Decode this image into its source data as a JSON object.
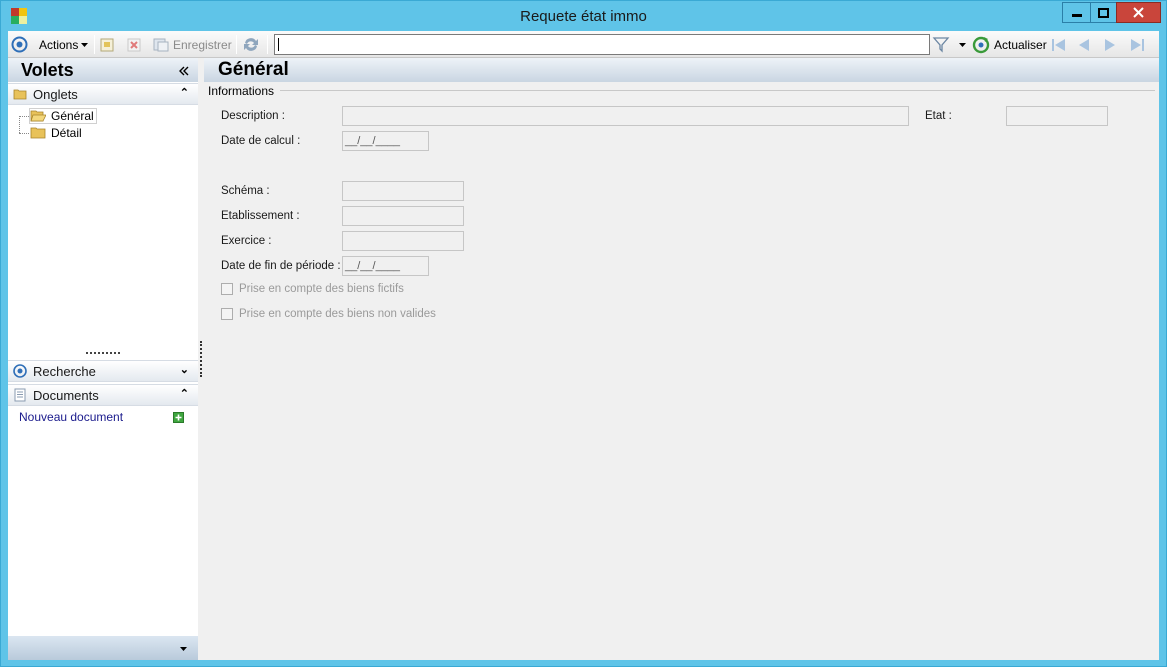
{
  "window": {
    "title": "Requete état immo"
  },
  "toolbar": {
    "actions_label": "Actions",
    "save_label": "Enregistrer",
    "search_value": "",
    "refresh_label": "Actualiser"
  },
  "left": {
    "volets_title": "Volets",
    "onglets_label": "Onglets",
    "tree": [
      {
        "label": "Général"
      },
      {
        "label": "Détail"
      }
    ],
    "recherche_label": "Recherche",
    "documents_label": "Documents",
    "new_document_label": "Nouveau document"
  },
  "main": {
    "title": "Général",
    "group_label": "Informations",
    "labels": {
      "description": "Description :",
      "etat": "Etat :",
      "date_calcul": "Date de calcul :",
      "schema": "Schéma :",
      "etablissement": "Etablissement :",
      "exercice": "Exercice :",
      "date_fin": "Date de fin de période :"
    },
    "values": {
      "description": "",
      "etat": "",
      "date_calcul": "__/__/____",
      "schema": "",
      "etablissement": "",
      "exercice": "",
      "date_fin": "__/__/____"
    },
    "checkboxes": {
      "fictifs": "Prise en compte des biens fictifs",
      "non_valides": "Prise en compte des biens non valides"
    }
  },
  "colors": {
    "titlebar": "#5fc4e8",
    "close": "#c9453b",
    "link": "#1a1a8c"
  }
}
